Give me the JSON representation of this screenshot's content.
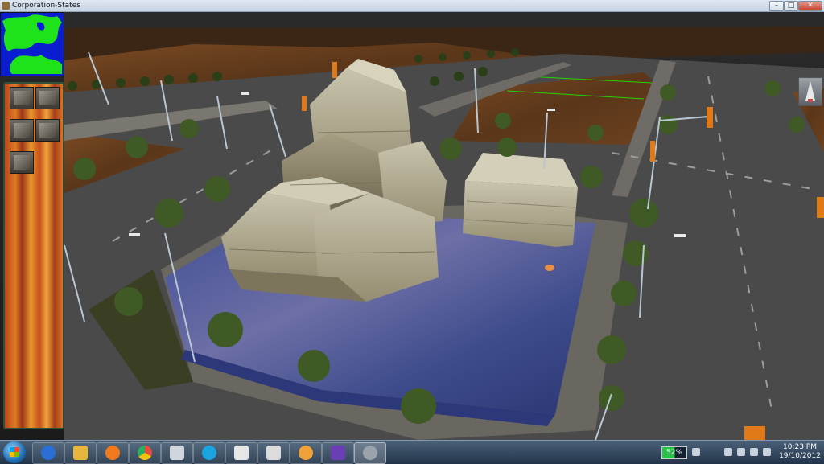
{
  "window": {
    "title": "Corporation-States",
    "min_glyph": "–",
    "max_glyph": "□",
    "close_glyph": "✕"
  },
  "icons": {
    "minimap": "minimap-icon",
    "build_tools": [
      "road-tool-icon",
      "building-tool-icon",
      "zone-tool-icon",
      "factory-tool-icon",
      "bulldoze-tool-icon"
    ],
    "camera": "camera-icon",
    "taskbar": [
      "internet-explorer-icon",
      "file-explorer-icon",
      "media-player-icon",
      "chrome-icon",
      "app-icon",
      "skype-icon",
      "counter-strike-icon",
      "window-app-icon",
      "paint-icon",
      "visual-studio-icon",
      "game-icon"
    ]
  },
  "colors": {
    "taskbar_icons": [
      "#2a6fd6",
      "#e8b63d",
      "#f07a1d",
      "#e74c3c",
      "#cfd6dd",
      "#1aa4e0",
      "#e6e6e6",
      "#dcdcdc",
      "#f0a23a",
      "#6a3fb6",
      "#9aa3ab"
    ],
    "accent_light": "#e8904a"
  },
  "taskbar": {
    "battery_percent": "52%",
    "time": "10:23 PM",
    "date": "19/10/2012"
  }
}
